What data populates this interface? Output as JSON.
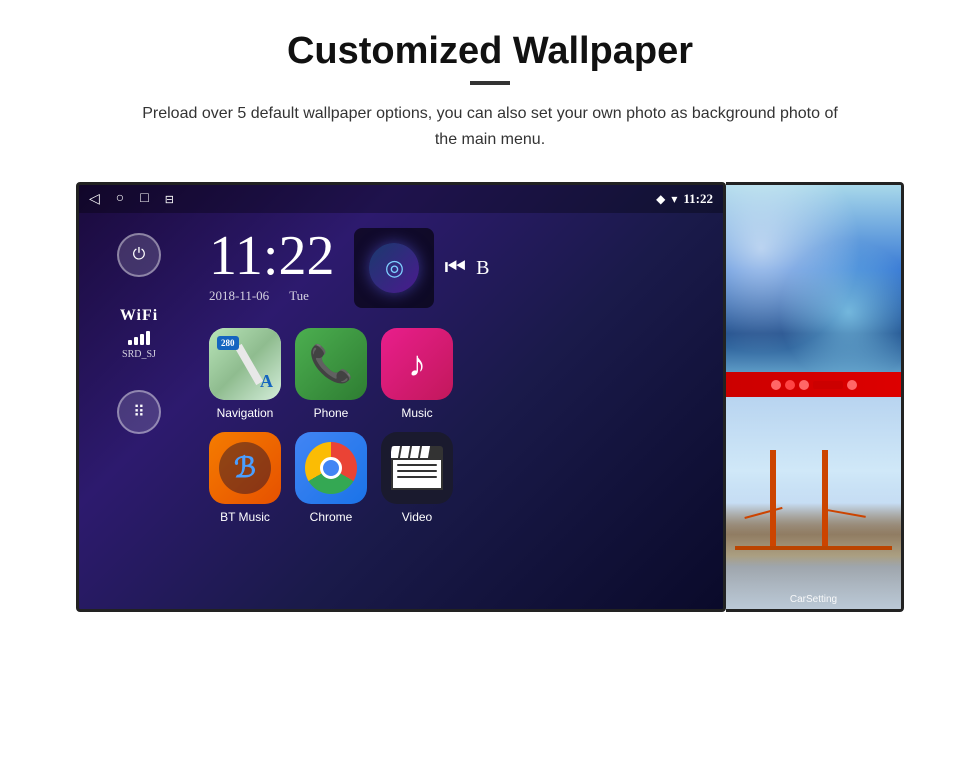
{
  "page": {
    "title": "Customized Wallpaper",
    "subtitle": "Preload over 5 default wallpaper options, you can also set your own photo as background photo of the main menu."
  },
  "android": {
    "time": "11:22",
    "date": "2018-11-06",
    "day": "Tue",
    "wifi_ssid": "SRD_SJ",
    "wifi_label": "WiFi"
  },
  "apps": [
    {
      "name": "Navigation",
      "row": 1
    },
    {
      "name": "Phone",
      "row": 1
    },
    {
      "name": "Music",
      "row": 1
    },
    {
      "name": "BT Music",
      "row": 2
    },
    {
      "name": "Chrome",
      "row": 2
    },
    {
      "name": "Video",
      "row": 2
    }
  ],
  "wallpapers": [
    {
      "name": "ice-cave",
      "label": "Ice/Blue Wallpaper"
    },
    {
      "name": "golden-gate",
      "label": "Golden Gate Bridge Wallpaper"
    },
    {
      "name": "car-setting",
      "label": "CarSetting"
    }
  ],
  "icons": {
    "power": "⏻",
    "back": "◁",
    "home": "○",
    "recents": "□",
    "gallery": "⊞",
    "gps": "⬡",
    "wifi_signal": "▾",
    "bluetooth": "ℬ"
  }
}
